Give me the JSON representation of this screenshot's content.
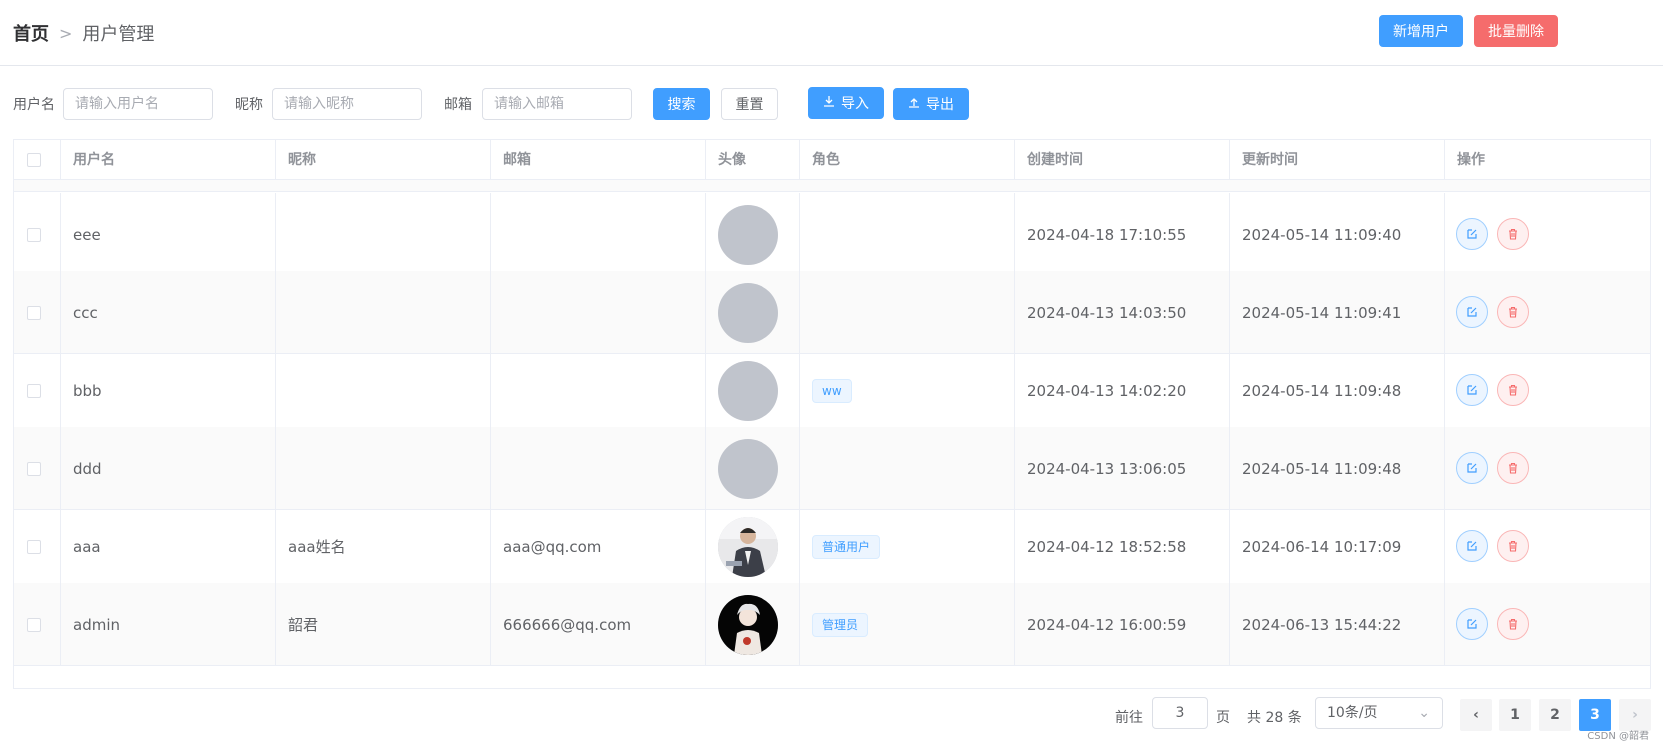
{
  "breadcrumb": {
    "home": "首页",
    "current": "用户管理"
  },
  "header_actions": {
    "add_label": "新增用户",
    "batch_delete_label": "批量删除"
  },
  "search": {
    "username_label": "用户名",
    "username_placeholder": "请输入用户名",
    "nickname_label": "昵称",
    "nickname_placeholder": "请输入昵称",
    "email_label": "邮箱",
    "email_placeholder": "请输入邮箱",
    "search_label": "搜索",
    "reset_label": "重置",
    "import_label": "导入",
    "export_label": "导出"
  },
  "table": {
    "columns": [
      "用户名",
      "昵称",
      "邮箱",
      "头像",
      "角色",
      "创建时间",
      "更新时间",
      "操作"
    ],
    "rows": [
      {
        "username": "eee",
        "nickname": "",
        "email": "",
        "role": "",
        "created": "2024-04-18 17:10:55",
        "updated": "2024-05-14 11:09:40",
        "avatar": "placeholder"
      },
      {
        "username": "ccc",
        "nickname": "",
        "email": "",
        "role": "",
        "created": "2024-04-13 14:03:50",
        "updated": "2024-05-14 11:09:41",
        "avatar": "placeholder"
      },
      {
        "username": "bbb",
        "nickname": "",
        "email": "",
        "role": "ww",
        "created": "2024-04-13 14:02:20",
        "updated": "2024-05-14 11:09:48",
        "avatar": "placeholder"
      },
      {
        "username": "ddd",
        "nickname": "",
        "email": "",
        "role": "",
        "created": "2024-04-13 13:06:05",
        "updated": "2024-05-14 11:09:48",
        "avatar": "placeholder"
      },
      {
        "username": "aaa",
        "nickname": "aaa姓名",
        "email": "aaa@qq.com",
        "role": "普通用户",
        "created": "2024-04-12 18:52:58",
        "updated": "2024-06-14 10:17:09",
        "avatar": "photo-businessman"
      },
      {
        "username": "admin",
        "nickname": "韶君",
        "email": "666666@qq.com",
        "role": "管理员",
        "created": "2024-04-12 16:00:59",
        "updated": "2024-06-13 15:44:22",
        "avatar": "photo-anime"
      }
    ]
  },
  "pagination": {
    "goto_prefix": "前往",
    "goto_value": "3",
    "goto_suffix": "页",
    "total_text": "共 28 条",
    "page_size": "10条/页",
    "pages": [
      "1",
      "2",
      "3"
    ],
    "current_page": "3"
  },
  "watermark": "CSDN @韶君",
  "colors": {
    "primary": "#409eff",
    "danger": "#f56c6c",
    "avatar_placeholder": "#c0c4cc"
  }
}
